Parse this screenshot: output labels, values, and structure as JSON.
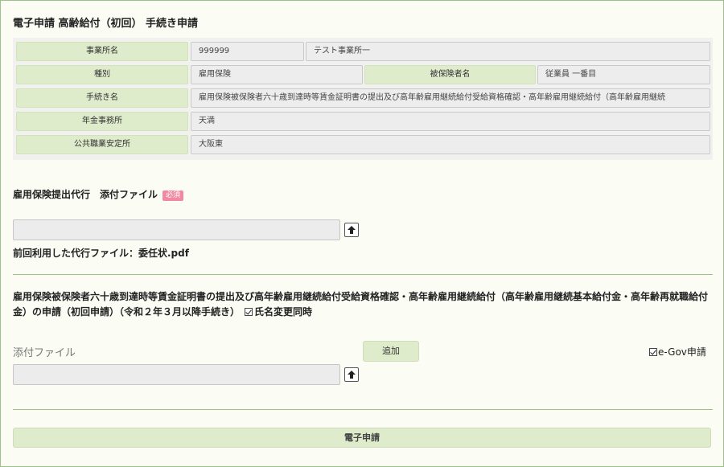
{
  "page": {
    "title": "電子申請 高齢給付（初回） 手続き申請"
  },
  "info": {
    "office_label": "事業所名",
    "office_code": "999999",
    "office_name": "テスト事業所一",
    "type_label": "種別",
    "type_value": "雇用保険",
    "insured_label": "被保険者名",
    "insured_value": "従業員 一番目",
    "procedure_label": "手続き名",
    "procedure_value": "雇用保険被保険者六十歳到達時等賃金証明書の提出及び高年齢雇用継続給付受給資格確認・高年齢雇用継続給付（高年齢雇用継続",
    "pension_office_label": "年金事務所",
    "pension_office_value": "天満",
    "employment_office_label": "公共職業安定所",
    "employment_office_value": "大阪東"
  },
  "proxy": {
    "heading": "雇用保険提出代行　添付ファイル",
    "required_badge": "必須",
    "previous_file": "前回利用した代行ファイル：委任状.pdf"
  },
  "application": {
    "description": "雇用保険被保険者六十歳到達時等賃金証明書の提出及び高年齢雇用継続給付受給資格確認・高年齢雇用継続給付（高年齢雇用継続基本給付金・高年齢再就職給付金）の申請（初回申請）（令和２年３月以降手続き）",
    "name_change_label": "氏名変更同時",
    "name_change_checked": true,
    "attach_label": "添付ファイル",
    "add_label": "追加",
    "egov_label": "e-Gov申請",
    "egov_checked": true
  },
  "footer": {
    "submit_label": "電子申請"
  },
  "icons": {
    "upload": "upload-arrow-icon",
    "checkbox": "checkbox-checked-icon"
  },
  "colors": {
    "label_bg": "#dfeccb",
    "value_bg": "#ededed",
    "accent_line": "#9bc28a",
    "required_badge": "#f08aa3"
  }
}
